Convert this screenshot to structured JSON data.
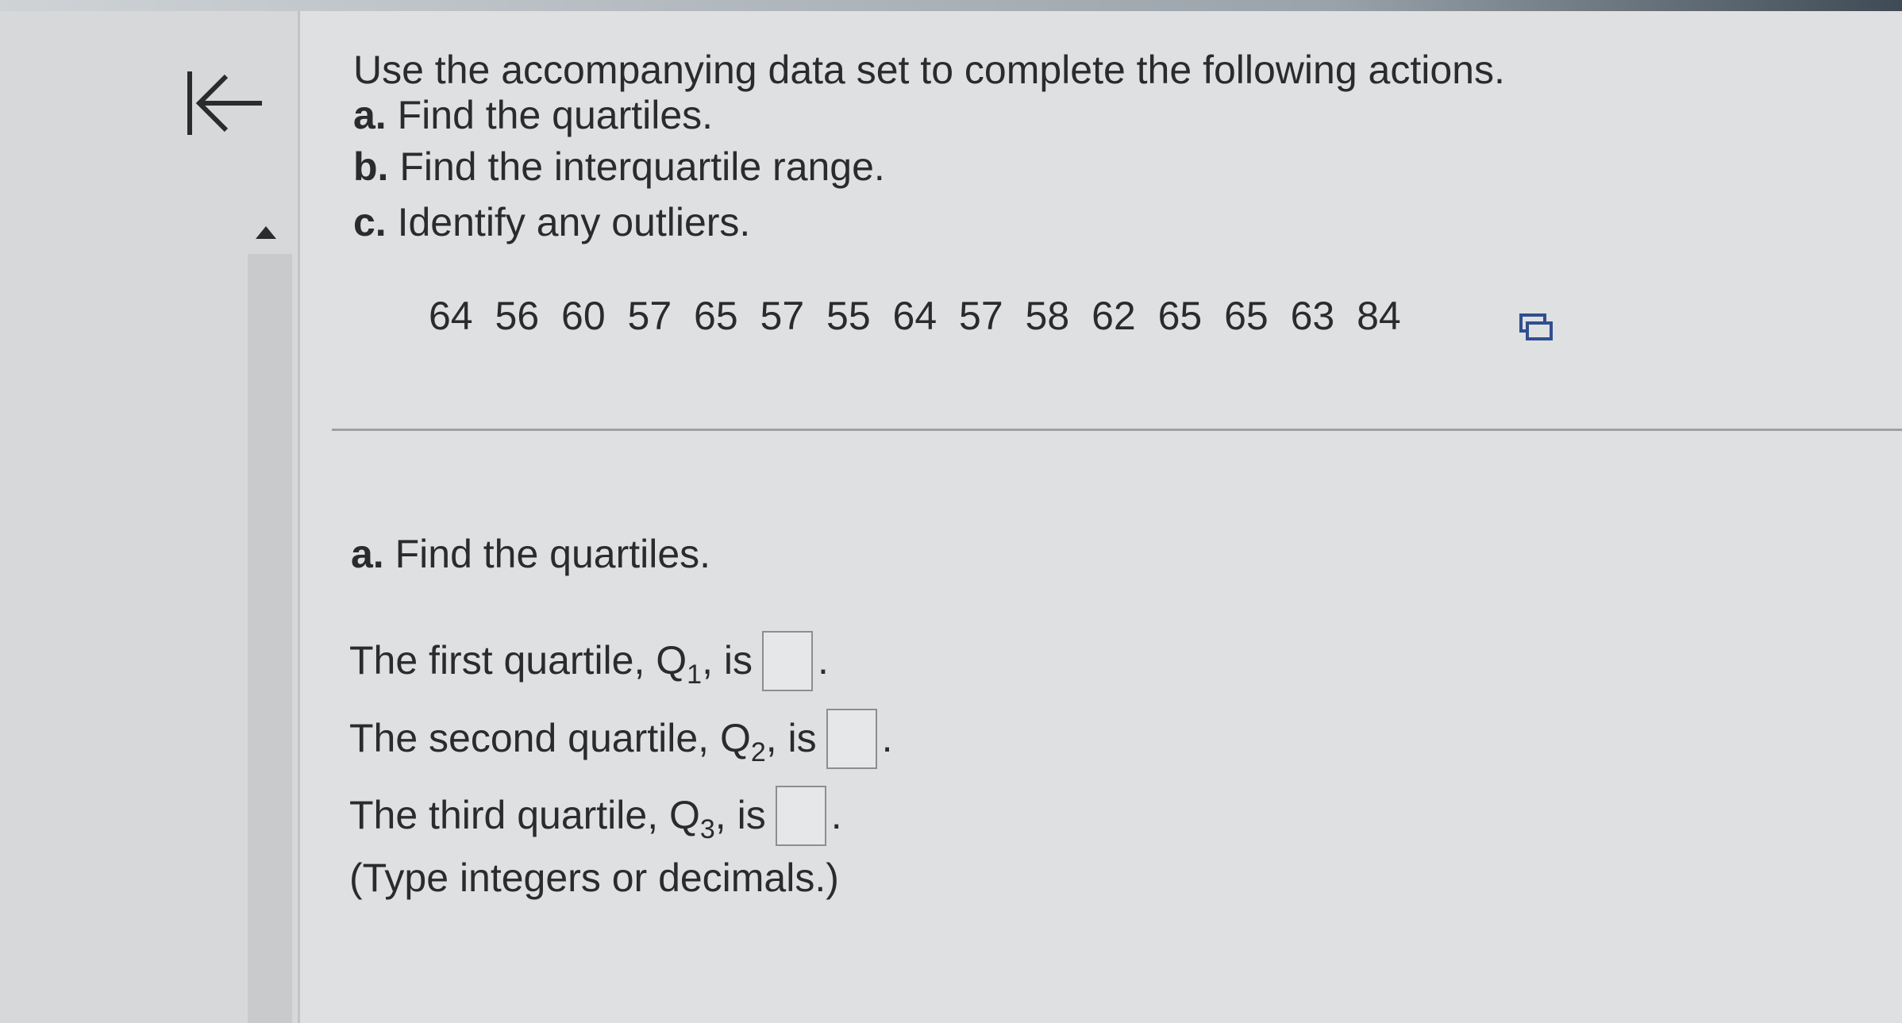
{
  "navigation": {
    "back_icon": "first-page-arrow-icon",
    "scroll_up_icon": "triangle-up-icon"
  },
  "question": {
    "intro": "Use the accompanying data set to complete the following actions.",
    "parts": [
      {
        "label": "a.",
        "text": "Find the quartiles."
      },
      {
        "label": "b.",
        "text": "Find the interquartile range."
      },
      {
        "label": "c.",
        "text": "Identify any outliers."
      }
    ],
    "dataset": "64 56 60 57 65 57 55 64 57 58 62 65 65 63 84",
    "copy_icon": "copy-data-icon"
  },
  "part_a": {
    "label": "a.",
    "heading": "Find the quartiles.",
    "q1": {
      "prefix": "The first quartile, Q",
      "sub": "1",
      "suffix": ", is",
      "value": ""
    },
    "q2": {
      "prefix": "The second quartile, Q",
      "sub": "2",
      "suffix": ", is",
      "value": ""
    },
    "q3": {
      "prefix": "The third quartile, Q",
      "sub": "3",
      "suffix": ", is",
      "value": ""
    },
    "period": ".",
    "hint": "(Type integers or decimals.)"
  }
}
